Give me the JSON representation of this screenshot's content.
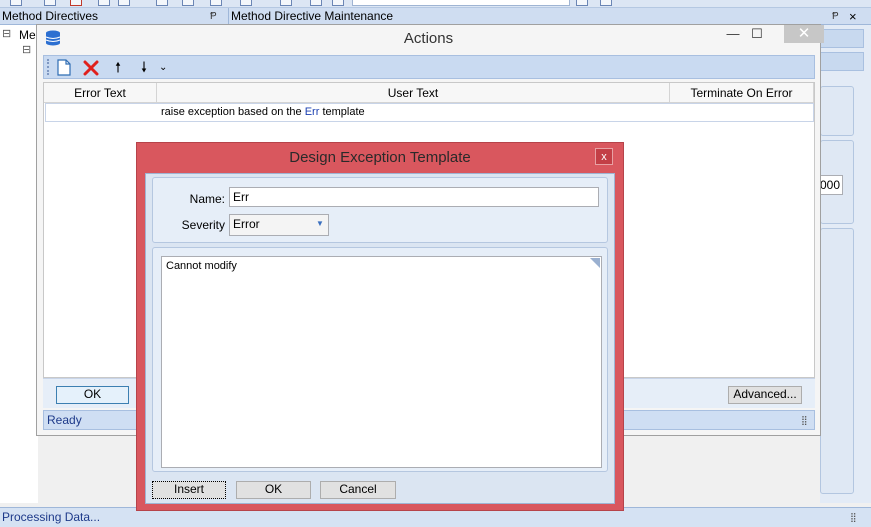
{
  "background": {
    "left_panel_title": "Method Directives",
    "right_panel_title": "Method Directive Maintenance",
    "tree_node_label": "Me",
    "tree_expander": "⊟",
    "right_field_fragment": "000",
    "pin_glyph": "Ᵽ",
    "close_glyph": "×",
    "status_text": "Processing Data..."
  },
  "actions_window": {
    "title": "Actions",
    "minimize": "—",
    "maximize": "☐",
    "close": "✕",
    "toolbar": {
      "new_icon": "new-document-icon",
      "delete_icon": "delete-icon",
      "up_glyph": "🠕",
      "down_glyph": "🠗",
      "overflow_glyph": "⌄"
    },
    "columns": [
      "Error Text",
      "User Text",
      "Terminate On Error"
    ],
    "rows": [
      {
        "error_text": "",
        "user_text_before": "raise exception based on the ",
        "user_text_highlight": "Err",
        "user_text_after": " template",
        "terminate_on_error": ""
      }
    ],
    "ok_label": "OK",
    "advanced_label": "Advanced...",
    "status": "Ready"
  },
  "dialog": {
    "title": "Design Exception Template",
    "close": "x",
    "name_label": "Name:",
    "name_value": "Err",
    "severity_label": "Severity",
    "severity_value": "Error",
    "message_text": "Cannot modify",
    "insert_label": "Insert",
    "ok_label": "OK",
    "cancel_label": "Cancel"
  },
  "colors": {
    "dialog_border": "#d9575e",
    "toolbar_blue": "#c9daf1",
    "highlight_text": "#1a3fb0"
  }
}
